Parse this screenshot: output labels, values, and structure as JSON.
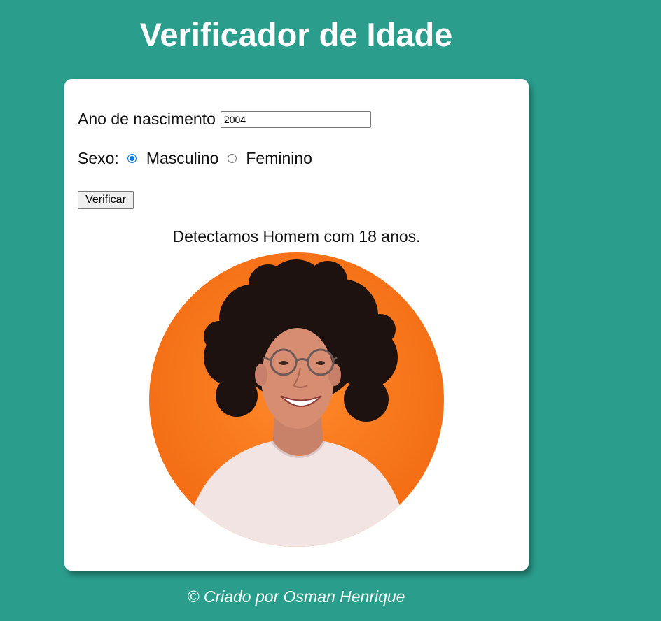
{
  "page": {
    "title": "Verificador de Idade",
    "footer": "© Criado por Osman Henrique"
  },
  "form": {
    "ano_label": "Ano de nascimento",
    "ano_value": "2004",
    "sexo_label": "Sexo:",
    "options": [
      {
        "label": "Masculino",
        "checked": true
      },
      {
        "label": "Feminino",
        "checked": false
      }
    ],
    "button_label": "Verificar"
  },
  "result": {
    "text": "Detectamos Homem com 18 anos.",
    "photo_icon": "person-photo"
  },
  "colors": {
    "background": "#2a9d8c",
    "card": "#ffffff",
    "accent": "#0075ff",
    "photo_bg": "#f77a1c"
  }
}
